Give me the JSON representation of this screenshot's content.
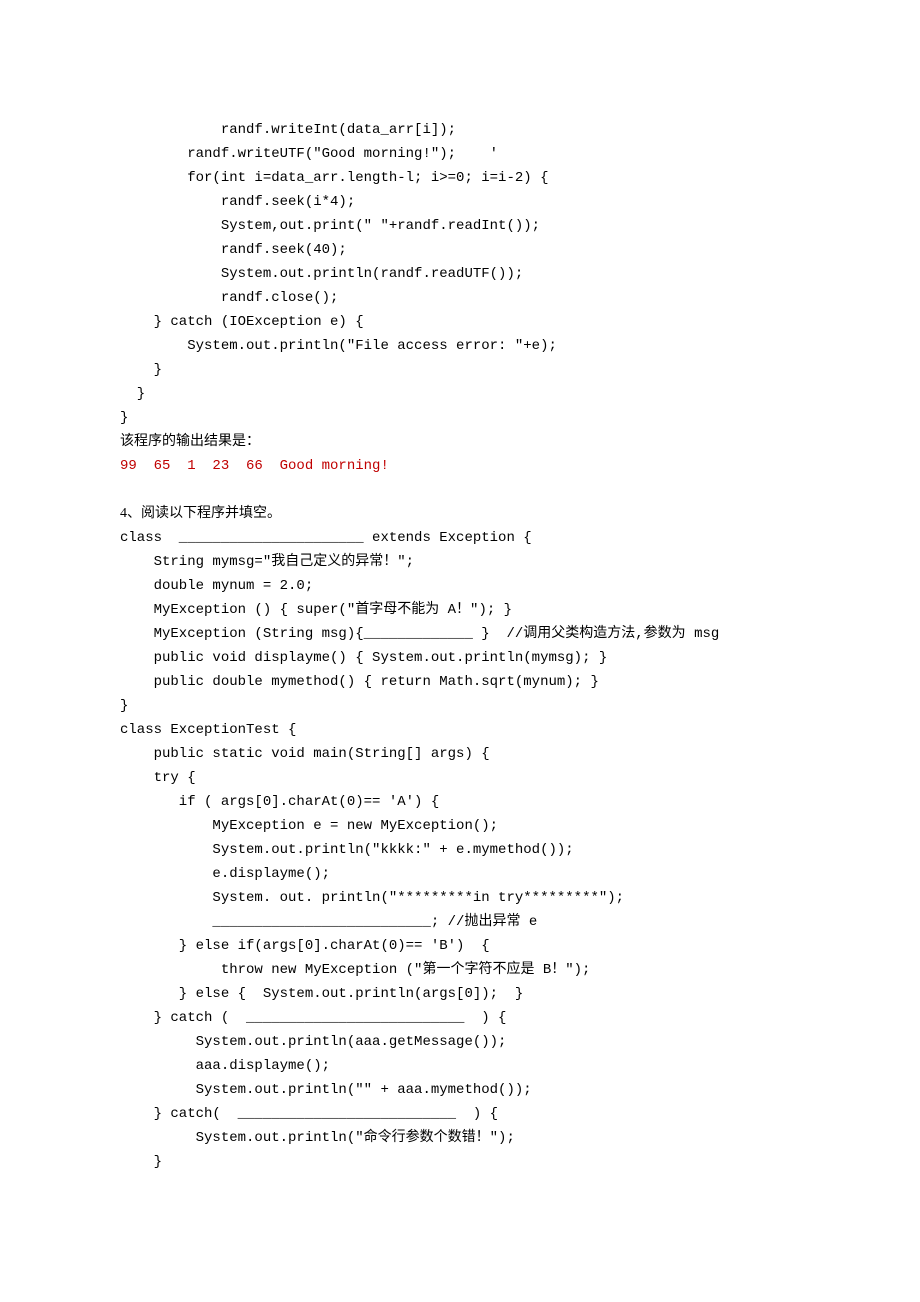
{
  "code1": {
    "l1": "            randf.writeInt(data_arr[i]);",
    "l2": "        randf.writeUTF(\"Good morning!\");    '",
    "l3": "        for(int i=data_arr.length-l; i>=0; i=i-2) {",
    "l4": "            randf.seek(i*4);",
    "l5": "            System,out.print(\" \"+randf.readInt());",
    "l6": "            randf.seek(40);",
    "l7": "            System.out.println(randf.readUTF());",
    "l8": "            randf.close();",
    "l9": "    } catch (IOException e) {",
    "l10": "        System.out.println(\"File access error: \"+e);",
    "l11": "    }",
    "l12": "  }",
    "l13": "}"
  },
  "result": {
    "label": "该程序的输出结果是：",
    "value": "99  65  1  23  66  Good morning!"
  },
  "q4": {
    "title": "4、阅读以下程序并填空。",
    "l1": "class  ______________________ extends Exception {",
    "l2": "    String mymsg=\"我自己定义的异常！\";",
    "l3": "    double mynum = 2.0;",
    "l4": "    MyException () { super(\"首字母不能为 A！\"); }",
    "l5": "    MyException (String msg){_____________ }  //调用父类构造方法,参数为 msg",
    "l6": "    public void displayme() { System.out.println(mymsg); }",
    "l7": "    public double mymethod() { return Math.sqrt(mynum); }",
    "l8": "}",
    "l9": "class ExceptionTest {",
    "l10": "    public static void main(String[] args) {",
    "l11": "    try {",
    "l12": "       if ( args[0].charAt(0)== 'A') {",
    "l13": "           MyException e = new MyException();",
    "l14": "           System.out.println(\"kkkk:\" + e.mymethod());",
    "l15": "           e.displayme();",
    "l16": "           System. out. println(\"*********in try*********\");",
    "l17": "           __________________________; //抛出异常 e",
    "l18": "       } else if(args[0].charAt(0)== 'B')  {",
    "l19": "            throw new MyException (\"第一个字符不应是 B！\");",
    "l20": "       } else {  System.out.println(args[0]);  }",
    "l21": "    } catch (  __________________________  ) {",
    "l22": "         System.out.println(aaa.getMessage());",
    "l23": "         aaa.displayme();",
    "l24": "         System.out.println(\"\" + aaa.mymethod());",
    "l25": "    } catch(  __________________________  ) {",
    "l26": "         System.out.println(\"命令行参数个数错！\");",
    "l27": "    }"
  }
}
